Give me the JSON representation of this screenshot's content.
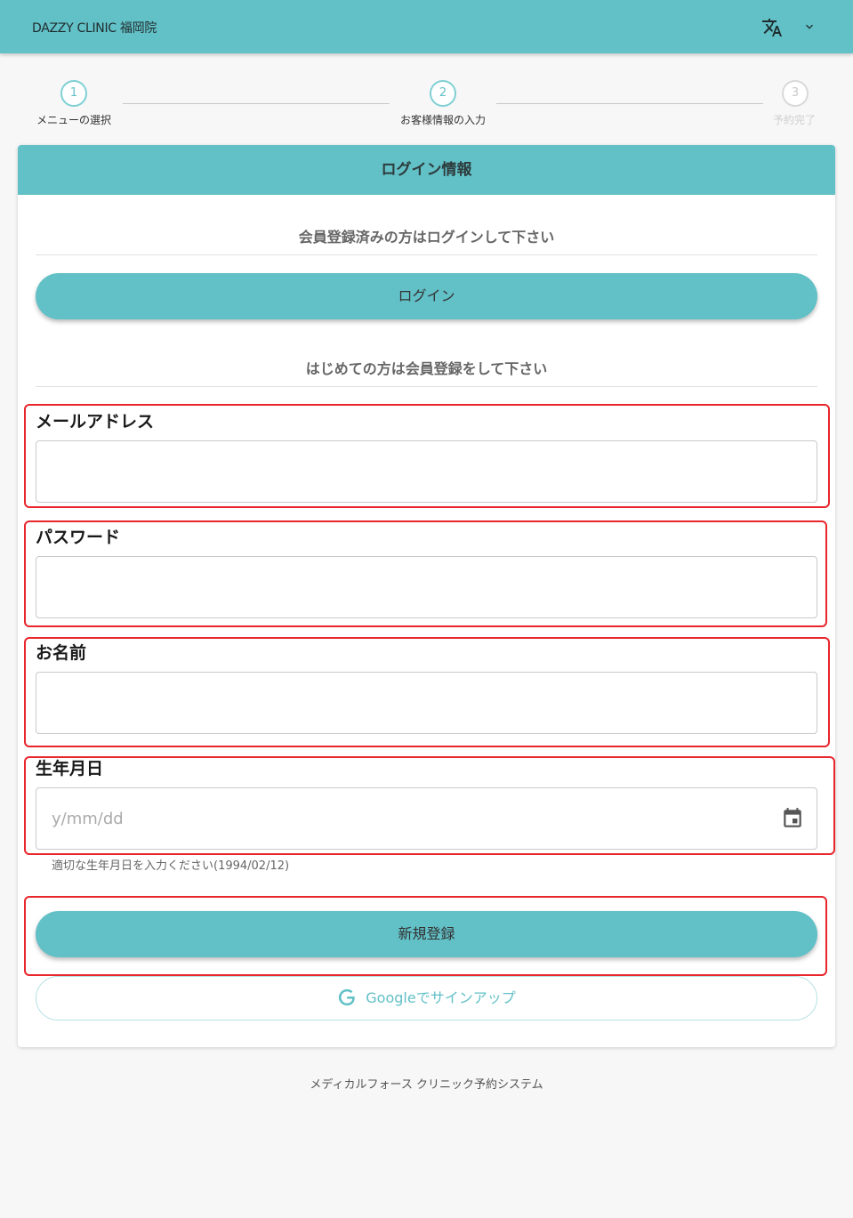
{
  "header": {
    "title": "DAZZY CLINIC 福岡院",
    "translate_icon": "translate-icon",
    "expand_icon": "chevron-down-icon"
  },
  "stepper": {
    "steps": [
      {
        "number": "1",
        "label": "メニューの選択",
        "state": "active"
      },
      {
        "number": "2",
        "label": "お客様情報の入力",
        "state": "active"
      },
      {
        "number": "3",
        "label": "予約完了",
        "state": "inactive"
      }
    ]
  },
  "card": {
    "title": "ログイン情報",
    "login_section_title": "会員登録済みの方はログインして下さい",
    "login_button": "ログイン",
    "register_section_title": "はじめての方は会員登録をして下さい",
    "fields": {
      "email": {
        "label": "メールアドレス",
        "value": "",
        "placeholder": ""
      },
      "password": {
        "label": "パスワード",
        "value": "",
        "placeholder": ""
      },
      "name": {
        "label": "お名前",
        "value": "",
        "placeholder": ""
      },
      "birthday": {
        "label": "生年月日",
        "value": "",
        "placeholder": "y/mm/dd",
        "helper": "適切な生年月日を入力ください(1994/02/12)",
        "icon": "calendar-icon"
      }
    },
    "register_button": "新規登録",
    "google_button": "Googleでサインアップ"
  },
  "footer": {
    "text": "メディカルフォース クリニック予約システム"
  },
  "colors": {
    "primary": "#62c0c7",
    "highlight": "#e8262c",
    "background": "#f7f7f7"
  }
}
